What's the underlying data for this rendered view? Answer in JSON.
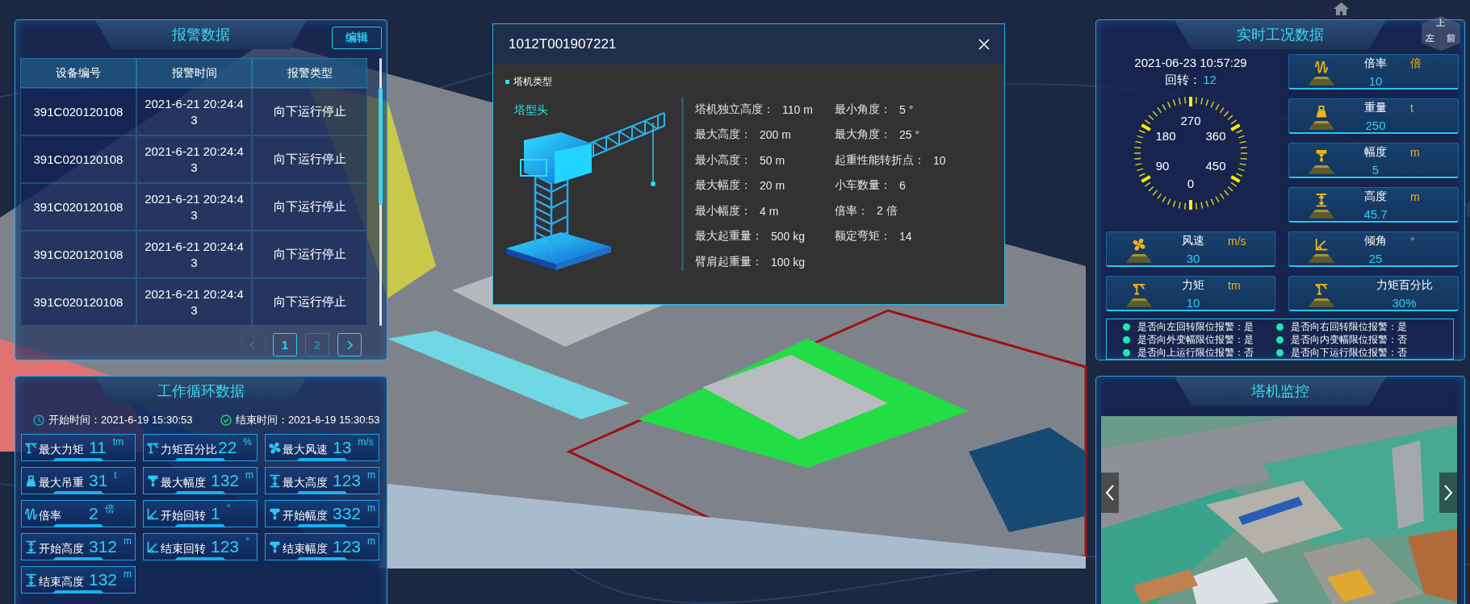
{
  "view_cube": {
    "labels": [
      "上",
      "左",
      "前"
    ]
  },
  "alarm_panel": {
    "title": "报警数据",
    "edit_button": "编辑",
    "columns": [
      "设备编号",
      "报警时间",
      "报警类型"
    ],
    "rows": [
      {
        "device": "391C020120108",
        "time": "2021-6-21 20:24:43",
        "type": "向下运行停止"
      },
      {
        "device": "391C020120108",
        "time": "2021-6-21 20:24:43",
        "type": "向下运行停止"
      },
      {
        "device": "391C020120108",
        "time": "2021-6-21 20:24:43",
        "type": "向下运行停止"
      },
      {
        "device": "391C020120108",
        "time": "2021-6-21 20:24:43",
        "type": "向下运行停止"
      },
      {
        "device": "391C020120108",
        "time": "2021-6-21 20:24:43",
        "type": "向下运行停止"
      }
    ],
    "pagination": {
      "previous": {
        "disabled": true
      },
      "pages": [
        {
          "label": "1",
          "selected": true
        },
        {
          "label": "2",
          "selected": false
        }
      ],
      "next": {
        "disabled": false
      }
    }
  },
  "cycle_panel": {
    "title": "工作循环数据",
    "start_time": "开始时间：2021-6-19 15:30:53",
    "end_time": "结束时间：2021-6-19 15:30:53",
    "metrics": [
      {
        "kind": "torque",
        "label": "最大力矩",
        "value": "11",
        "unit": "tm"
      },
      {
        "kind": "torque",
        "label": "力矩百分比",
        "value": "22",
        "unit": "%"
      },
      {
        "kind": "fan",
        "label": "最大风速",
        "value": "13",
        "unit": "m/s"
      },
      {
        "kind": "weight",
        "label": "最大吊重",
        "value": "31",
        "unit": "t"
      },
      {
        "kind": "trolley",
        "label": "最大幅度",
        "value": "132",
        "unit": "m"
      },
      {
        "kind": "height",
        "label": "最大高度",
        "value": "123",
        "unit": "m"
      },
      {
        "kind": "rate",
        "label": "倍率",
        "value": "2",
        "unit": "倍"
      },
      {
        "kind": "angle",
        "label": "开始回转",
        "value": "1",
        "unit": "°"
      },
      {
        "kind": "trolley",
        "label": "开始幅度",
        "value": "332",
        "unit": "m"
      },
      {
        "kind": "height",
        "label": "开始高度",
        "value": "312",
        "unit": "m"
      },
      {
        "kind": "angle",
        "label": "结束回转",
        "value": "123",
        "unit": "°"
      },
      {
        "kind": "trolley",
        "label": "结束幅度",
        "value": "123",
        "unit": "m"
      },
      {
        "kind": "height",
        "label": "结束高度",
        "value": "132",
        "unit": "m"
      }
    ]
  },
  "crane_popup": {
    "title": "1012T001907221",
    "section": "塔机类型",
    "crane_type": "塔型头",
    "specs_left": [
      {
        "label": "塔机独立高度：",
        "value": "110 m"
      },
      {
        "label": "最大高度：",
        "value": "200 m"
      },
      {
        "label": "最小高度：",
        "value": "50 m"
      },
      {
        "label": "最大幅度：",
        "value": "20 m"
      },
      {
        "label": "最小幅度：",
        "value": "4 m"
      },
      {
        "label": "最大起重量：",
        "value": "500 kg"
      },
      {
        "label": "臂肩起重量：",
        "value": "100 kg"
      }
    ],
    "specs_right": [
      {
        "label": "最小角度：",
        "value": "5 °"
      },
      {
        "label": "最大角度：",
        "value": "25 °"
      },
      {
        "label": "起重性能转折点：",
        "value": "10"
      },
      {
        "label": "小车数量：",
        "value": "6"
      },
      {
        "label": "倍率：",
        "value": "2 倍"
      },
      {
        "label": "额定弯矩：",
        "value": "14"
      }
    ]
  },
  "realtime_panel": {
    "title": "实时工况数据",
    "timestamp": "2021-06-23 10:57:29",
    "rotation": {
      "label": "回转：",
      "value": "12"
    },
    "dial_labels": [
      "270",
      "180",
      "360",
      "90",
      "450",
      "0"
    ],
    "metrics": [
      {
        "kind": "rate",
        "label": "倍率",
        "unit": "倍",
        "value": "10"
      },
      {
        "kind": "weight",
        "label": "重量",
        "unit": "t",
        "value": "250"
      },
      {
        "kind": "trolley",
        "label": "幅度",
        "unit": "m",
        "value": "5"
      },
      {
        "kind": "height",
        "label": "高度",
        "unit": "m",
        "value": "45.7"
      },
      {
        "kind": "fan",
        "label": "风速",
        "unit": "m/s",
        "value": "30"
      },
      {
        "kind": "angle",
        "label": "倾角",
        "unit": "°",
        "value": "25"
      },
      {
        "kind": "torque",
        "label": "力矩",
        "unit": "tm",
        "value": "10"
      },
      {
        "kind": "torque",
        "label": "力矩百分比",
        "value": "30%"
      }
    ],
    "alarms": [
      "是否向左回转限位报警：是",
      "是否向右回转限位报警：是",
      "是否向外变幅限位报警：是",
      "是否向内变幅限位报警：否",
      "是否向上运行限位报警：否",
      "是否向下运行限位报警：否"
    ]
  },
  "monitor_panel": {
    "title": "塔机监控"
  }
}
